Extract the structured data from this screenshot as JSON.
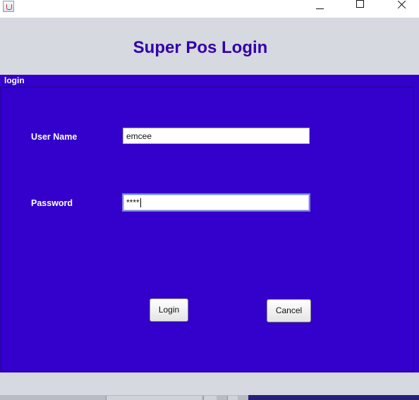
{
  "window": {
    "icon": "java-cup-icon",
    "controls": [
      "minimize-icon",
      "maximize-icon",
      "close-icon"
    ]
  },
  "header": {
    "title": "Super Pos Login"
  },
  "panel": {
    "caption": "login",
    "background": "#3300cc"
  },
  "form": {
    "username_label": "User Name",
    "username_value": "emcee",
    "password_label": "Password",
    "password_value": "****"
  },
  "buttons": {
    "login_label": "Login",
    "cancel_label": "Cancel"
  },
  "colors": {
    "title": "#3300aa",
    "panel": "#3300cc",
    "chrome": "#d6d9df"
  }
}
